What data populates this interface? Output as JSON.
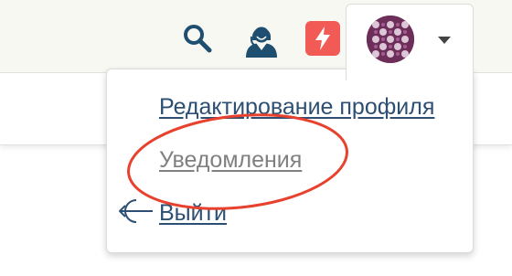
{
  "header": {
    "icons": {
      "search": "search-icon",
      "support": "support-agent-icon",
      "flash": "lightning-icon",
      "avatar": "avatar",
      "caret": "chevron-down-icon"
    }
  },
  "user_menu": {
    "items": [
      {
        "label": "Редактирование профиля",
        "icon": ""
      },
      {
        "label": "Уведомления",
        "icon": ""
      },
      {
        "label": "Выйти",
        "icon": "logout-icon"
      }
    ]
  },
  "colors": {
    "link": "#2c4f73",
    "link_muted": "#808080",
    "flash_badge": "#f15a55",
    "icon": "#1f4f70",
    "highlight": "#e8412e"
  }
}
